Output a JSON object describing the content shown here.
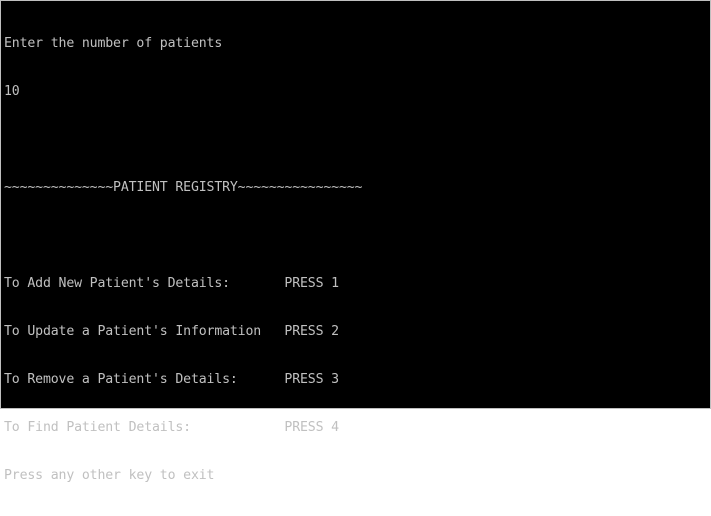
{
  "console": {
    "lines": [
      "Enter the number of patients",
      "10",
      "",
      "~~~~~~~~~~~~~~PATIENT REGISTRY~~~~~~~~~~~~~~~~",
      "",
      "To Add New Patient's Details:       PRESS 1",
      "To Update a Patient's Information   PRESS 2",
      "To Remove a Patient's Details:      PRESS 3",
      "To Find Patient Details:            PRESS 4",
      "Press any other key to exit"
    ],
    "colors": {
      "background": "#000000",
      "text": "#c0c0c0",
      "frame": "#bfbfbf"
    }
  }
}
